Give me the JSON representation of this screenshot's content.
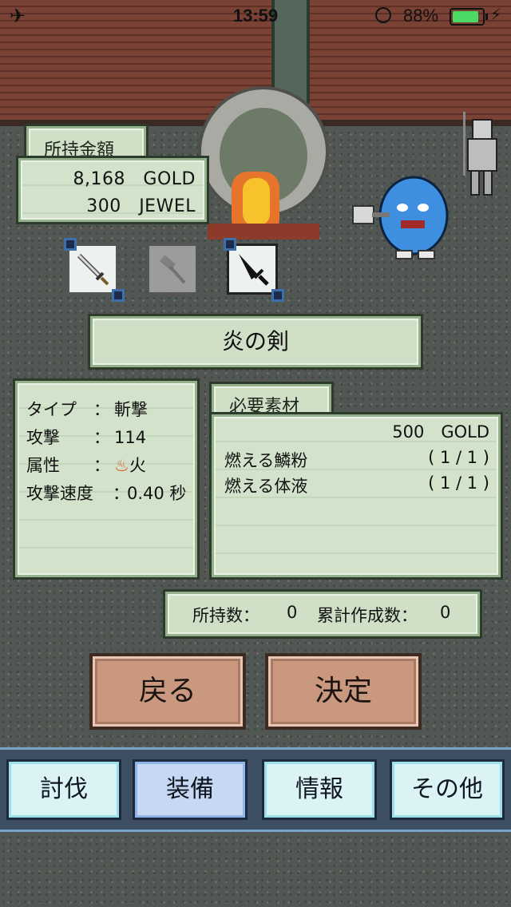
{
  "status_bar": {
    "time": "13:59",
    "battery_percent": "88%"
  },
  "wallet": {
    "title": "所持金額",
    "gold": "8,168　GOLD",
    "jewel": "300　JEWEL"
  },
  "item_slots": [
    {
      "icon": "sword-icon",
      "state": "normal"
    },
    {
      "icon": "hammer-icon",
      "state": "disabled"
    },
    {
      "icon": "flame-sword-icon",
      "state": "selected"
    }
  ],
  "item_name": "炎の剣",
  "stats": {
    "rows": [
      {
        "key": "タイプ",
        "sep": "：",
        "value": "斬撃"
      },
      {
        "key": "攻撃",
        "sep": "：",
        "value": "114"
      },
      {
        "key": "属性",
        "sep": "：",
        "value": "火",
        "icon": "fire-icon"
      },
      {
        "key": "攻撃速度",
        "sep": "：",
        "value": "0.40 秒"
      }
    ]
  },
  "materials": {
    "title": "必要素材",
    "cost": "500　GOLD",
    "items": [
      {
        "name": "燃える鱗粉",
        "count": "( 1 / 1 )"
      },
      {
        "name": "燃える体液",
        "count": "( 1 / 1 )"
      }
    ]
  },
  "counts": {
    "owned_label": "所持数：",
    "owned_value": "0",
    "crafted_label": "累計作成数：",
    "crafted_value": "0"
  },
  "actions": {
    "back": "戻る",
    "confirm": "決定"
  },
  "tabs": [
    {
      "label": "討伐",
      "active": false
    },
    {
      "label": "装備",
      "active": true
    },
    {
      "label": "情報",
      "active": false
    },
    {
      "label": "その他",
      "active": false
    }
  ],
  "colors": {
    "panel": "#cfe0c7",
    "button": "#c9987f",
    "tab": "#dcf3f6",
    "tab_active": "#c6d8f3"
  }
}
